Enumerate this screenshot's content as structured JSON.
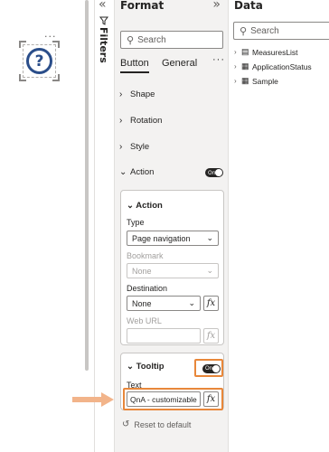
{
  "canvas": {
    "visual_more": "···",
    "visual_icon": "?"
  },
  "filters_pane": {
    "collapse_glyph": "«",
    "label": "Filters"
  },
  "format_pane": {
    "title": "Format",
    "expand_glyph": "»",
    "search_placeholder": "Search",
    "tabs": [
      {
        "label": "Button",
        "active": true
      },
      {
        "label": "General",
        "active": false
      }
    ],
    "more_glyph": "···",
    "sections": [
      {
        "label": "Shape"
      },
      {
        "label": "Rotation"
      },
      {
        "label": "Style"
      },
      {
        "label": "Action",
        "expanded": true,
        "toggle": "On"
      }
    ],
    "action_card": {
      "header": "Action",
      "type_label": "Type",
      "type_value": "Page navigation",
      "bookmark_label": "Bookmark",
      "bookmark_value": "None",
      "destination_label": "Destination",
      "destination_value": "None",
      "weburl_label": "Web URL",
      "fx_label": "fx"
    },
    "tooltip_card": {
      "header": "Tooltip",
      "toggle": "On",
      "text_label": "Text",
      "text_value": "QnA - customizable",
      "fx_label": "fx"
    },
    "reset_label": "Reset to default",
    "highlight_color": "#e8873a"
  },
  "data_pane": {
    "title": "Data",
    "search_placeholder": "Search",
    "items": [
      {
        "label": "MeasuresList",
        "icon": "measure-table-icon"
      },
      {
        "label": "ApplicationStatus",
        "icon": "table-icon"
      },
      {
        "label": "Sample",
        "icon": "table-icon"
      }
    ]
  }
}
